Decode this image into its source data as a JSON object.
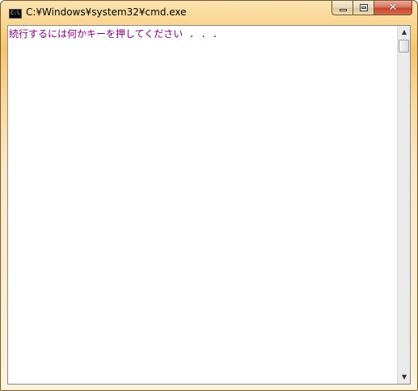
{
  "window": {
    "title": "C:¥Windows¥system32¥cmd.exe",
    "app_icon_text": "C:\\",
    "buttons": {
      "minimize_icon": "minimize-icon",
      "maximize_icon": "maximize-icon",
      "close_icon": "close-icon",
      "close_glyph": "✕"
    }
  },
  "console": {
    "lines": [
      "続行するには何かキーを押してください . . ."
    ],
    "text_color": "#800080",
    "background_color": "#ffffff"
  },
  "scrollbar": {
    "up_arrow": "▲",
    "down_arrow": "▼"
  }
}
